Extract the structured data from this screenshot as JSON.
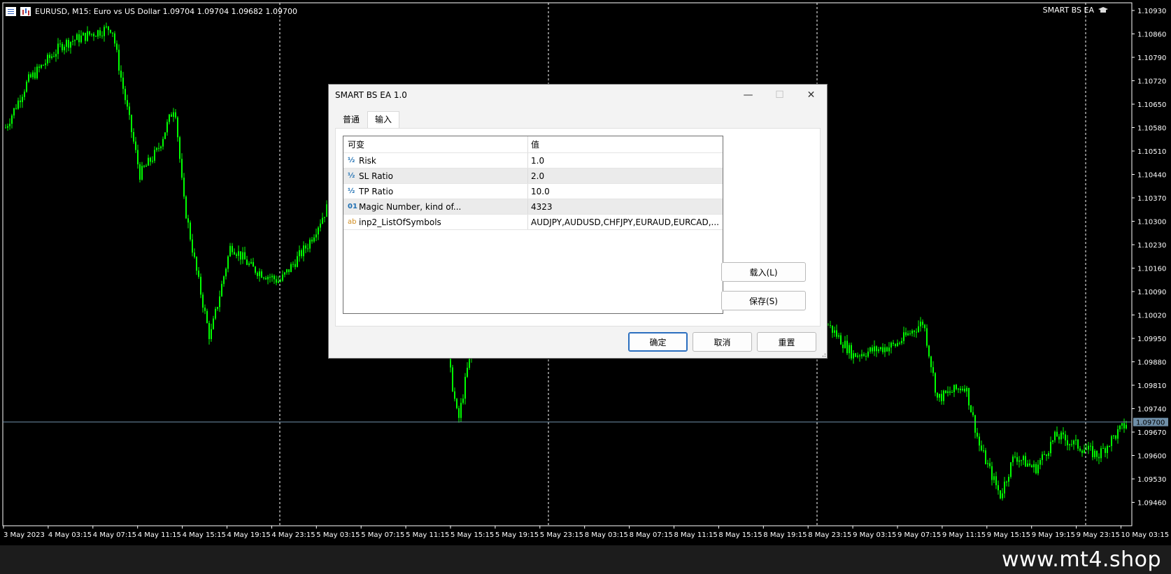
{
  "colors": {
    "background": "#000000",
    "candles": "#00ff00",
    "grid": "#ffffff",
    "bid_line": "#6f8fa8",
    "price_tag": "#6f8fa8"
  },
  "chart": {
    "header": "EURUSD, M15:  Euro vs US Dollar  1.09704 1.09704 1.09682 1.09700",
    "ea_label": "SMART BS EA",
    "icons": [
      "list-icon",
      "bar-chart-icon",
      "graduation-cap-icon"
    ],
    "price_labels": [
      "1.10930",
      "1.10860",
      "1.10790",
      "1.10720",
      "1.10650",
      "1.10580",
      "1.10510",
      "1.10440",
      "1.10370",
      "1.10300",
      "1.10230",
      "1.10160",
      "1.10090",
      "1.10020",
      "1.09950",
      "1.09880",
      "1.09810",
      "1.09740",
      "1.09670",
      "1.09600",
      "1.09530",
      "1.09460"
    ],
    "current_price": "1.09700",
    "time_labels": [
      "3 May 2023",
      "4 May 03:15",
      "4 May 07:15",
      "4 May 11:15",
      "4 May 15:15",
      "4 May 19:15",
      "4 May 23:15",
      "5 May 03:15",
      "5 May 07:15",
      "5 May 11:15",
      "5 May 15:15",
      "5 May 19:15",
      "5 May 23:15",
      "8 May 03:15",
      "8 May 07:15",
      "8 May 11:15",
      "8 May 15:15",
      "8 May 19:15",
      "8 May 23:15",
      "9 May 03:15",
      "9 May 07:15",
      "9 May 11:15",
      "9 May 15:15",
      "9 May 19:15",
      "9 May 23:15",
      "10 May 03:15"
    ]
  },
  "dialog": {
    "title": "SMART BS EA 1.0",
    "controls": {
      "minimize": "—",
      "maximize": "☐",
      "close": "✕"
    },
    "tabs": [
      {
        "label": "普通"
      },
      {
        "label": "输入"
      }
    ],
    "table": {
      "headers": [
        "可变",
        "值"
      ],
      "rows": [
        {
          "type": "½",
          "name": "Risk",
          "value": "1.0"
        },
        {
          "type": "½",
          "name": "SL Ratio",
          "value": "2.0"
        },
        {
          "type": "½",
          "name": "TP Ratio",
          "value": "10.0"
        },
        {
          "type": "01",
          "name": "Magic Number, kind of...",
          "value": "4323"
        },
        {
          "type": "ab",
          "name": "inp2_ListOfSymbols",
          "value": "AUDJPY,AUDUSD,CHFJPY,EURAUD,EURCAD,..."
        }
      ]
    },
    "side_buttons": {
      "load": "载入(L)",
      "save": "保存(S)"
    },
    "footer_buttons": {
      "ok": "确定",
      "cancel": "取消",
      "reset": "重置"
    }
  },
  "watermark": "www.mt4.shop"
}
